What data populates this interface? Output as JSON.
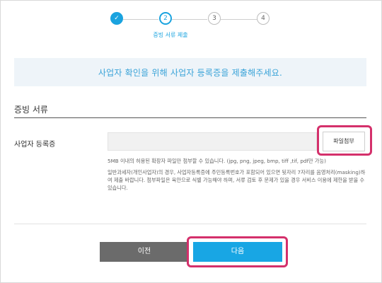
{
  "stepper": {
    "steps": [
      {
        "label": "✓",
        "state": "done"
      },
      {
        "label": "2",
        "state": "active"
      },
      {
        "label": "3",
        "state": "pending"
      },
      {
        "label": "4",
        "state": "pending"
      }
    ],
    "active_caption": "증빙 서류 제출"
  },
  "banner": {
    "text": "사업자 확인을 위해 사업자 등록증을 제출해주세요."
  },
  "section": {
    "title": "증빙 서류",
    "field_label": "사업자 등록증",
    "file_value": "",
    "attach_button": "파일첨부",
    "note_size": "5MB 이내의 허용된 확장자 파일만 첨부할 수 있습니다. (jpg, png, jpeg, bmp, tiff ,tif, pdf만 가능)",
    "note_masking": "일반과세자(개인사업자)의 경우, 사업자등록증에 주민등록번호가 포함되어 있으면 뒷자리 7자리를 음영처리(masking)하여 제출 바랍니다. 첨부파일은 육안으로 식별 가능해야 하며, 서류 검토 후 문제가 있을 경우 서비스 이용에 제한을 받을 수 있습니다."
  },
  "footer": {
    "prev_label": "이전",
    "next_label": "다음"
  },
  "colors": {
    "accent": "#1aa3df",
    "highlight": "#d4306b",
    "prev_button": "#6b6b6b",
    "banner_bg": "#eef4f9"
  }
}
